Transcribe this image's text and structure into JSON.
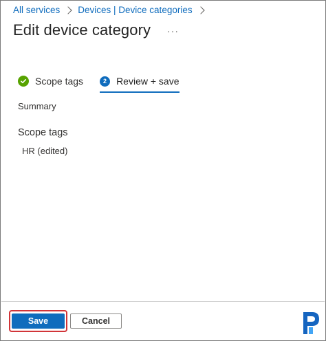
{
  "breadcrumb": {
    "items": [
      "All services",
      "Devices | Device categories"
    ]
  },
  "page": {
    "title": "Edit device category",
    "more_label": "···"
  },
  "steps": {
    "items": [
      {
        "label": "Scope tags",
        "state": "complete",
        "icon": "check-circle-icon"
      },
      {
        "label": "Review + save",
        "state": "active",
        "number": "2"
      }
    ]
  },
  "summary": {
    "heading": "Summary",
    "scope_tags_heading": "Scope tags",
    "scope_tags_value": "HR (edited)"
  },
  "footer": {
    "save_label": "Save",
    "cancel_label": "Cancel"
  },
  "colors": {
    "accent": "#0f6cbd",
    "success": "#57a300",
    "highlight": "#d13438",
    "logo": "#1565c0"
  }
}
